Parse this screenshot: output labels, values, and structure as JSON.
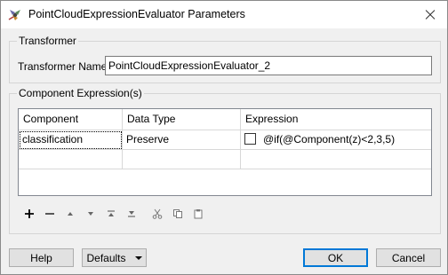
{
  "window": {
    "title": "PointCloudExpressionEvaluator Parameters",
    "app_icon": "fme-transformer-icon",
    "close_icon": "close-icon"
  },
  "transformer_group": {
    "title": "Transformer",
    "name_label": "Transformer Name:",
    "name_value": "PointCloudExpressionEvaluator_2"
  },
  "expressions_group": {
    "title": "Component Expression(s)",
    "columns": [
      "Component",
      "Data Type",
      "Expression"
    ],
    "rows": [
      {
        "component": "classification",
        "data_type": "Preserve",
        "expression_checkbox": false,
        "expression": "@if(@Component(z)<2,3,5)"
      },
      {
        "component": "",
        "data_type": "",
        "expression_checkbox": false,
        "expression": ""
      }
    ],
    "toolbar_icons": [
      "plus-icon",
      "minus-icon",
      "move-up-icon",
      "move-down-icon",
      "move-top-icon",
      "move-bottom-icon",
      "cut-icon",
      "copy-icon",
      "paste-icon"
    ]
  },
  "buttons": {
    "help": "Help",
    "defaults": "Defaults",
    "ok": "OK",
    "cancel": "Cancel"
  }
}
